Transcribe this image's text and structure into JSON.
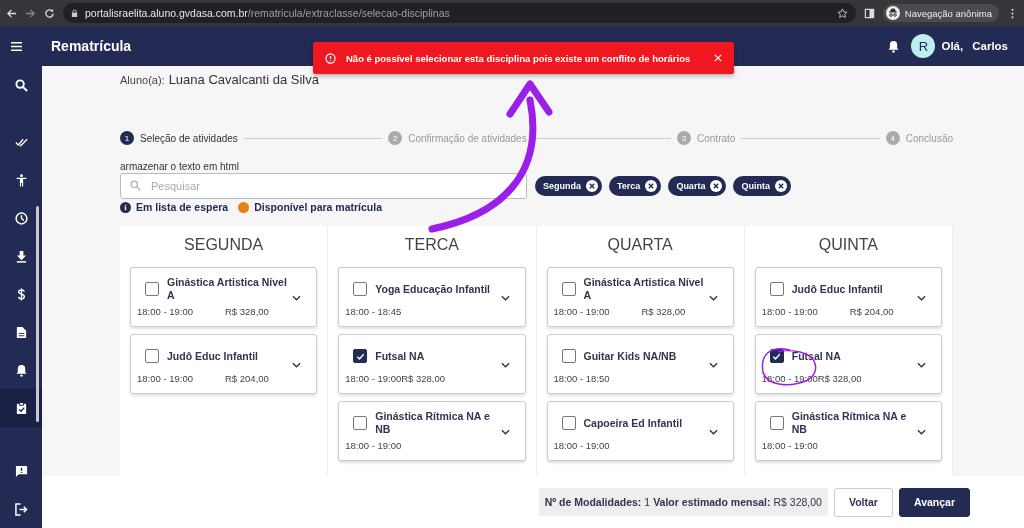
{
  "browser": {
    "url_domain": "portalisraelita.aluno.gvdasa.com.br",
    "url_path": "/rematricula/extraclasse/selecao-disciplinas",
    "profile": "Navegação anônima"
  },
  "header": {
    "title": "Rematrícula",
    "avatar": "R",
    "greeting": "Olá,",
    "user": "Carlos"
  },
  "sidebar": {
    "items": [
      {
        "kind": "search",
        "selected": false
      },
      {
        "kind": "double-check",
        "selected": false
      },
      {
        "kind": "person",
        "selected": false
      },
      {
        "kind": "clock",
        "selected": false
      },
      {
        "kind": "download",
        "selected": false
      },
      {
        "kind": "dollar",
        "selected": false
      },
      {
        "kind": "document",
        "selected": false
      },
      {
        "kind": "bell",
        "selected": false
      },
      {
        "kind": "clipboard",
        "selected": true
      },
      {
        "kind": "feedback",
        "selected": false
      },
      {
        "kind": "logout",
        "selected": false
      }
    ]
  },
  "toast": {
    "message": "Não é possível selecionar esta disciplina pois existe um conflito de horários"
  },
  "student": {
    "label": "Aluno(a):",
    "name": "Luana Cavalcanti da Silva"
  },
  "steps": [
    {
      "number": "1",
      "label": "Seleção de atividades",
      "selected": true
    },
    {
      "number": "2",
      "label": "Confirmação de atividades",
      "selected": false
    },
    {
      "number": "3",
      "label": "Contrato",
      "selected": false
    },
    {
      "number": "4",
      "label": "Conclusão",
      "selected": false
    }
  ],
  "search": {
    "label": "armazenar o texto em html",
    "placeholder": "Pesquisar"
  },
  "chips": [
    {
      "label": "Segunda"
    },
    {
      "label": "Terca"
    },
    {
      "label": "Quarta"
    },
    {
      "label": "Quinta"
    }
  ],
  "legend": [
    {
      "kind": "info",
      "label": "Em lista de espera"
    },
    {
      "kind": "dot",
      "label": "Disponível para matrícula"
    }
  ],
  "days": [
    {
      "name": "SEGUNDA",
      "activities": [
        {
          "name": "Ginástica Artistica Nível A",
          "time": "18:00 - 19:00",
          "price": "R$ 328,00",
          "checked": false
        },
        {
          "name": "Judô Educ Infantil",
          "time": "18:00 - 19:00",
          "price": "R$ 204,00",
          "checked": false
        }
      ]
    },
    {
      "name": "TERCA",
      "activities": [
        {
          "name": "Yoga Educação Infantil",
          "time": "18:00 - 18:45",
          "checked": false
        },
        {
          "name": "Futsal NA",
          "time": "18:00 - 19:00R$ 328,00",
          "checked": true
        },
        {
          "name": "Ginástica Rítmica NA e NB",
          "time": "18:00 - 19:00",
          "checked": false
        }
      ]
    },
    {
      "name": "QUARTA",
      "activities": [
        {
          "name": "Ginástica Artistica Nível A",
          "time": "18:00 - 19:00",
          "price": "R$ 328,00",
          "checked": false
        },
        {
          "name": "Guitar Kids NA/NB",
          "time": "18:00 - 18:50",
          "checked": false
        },
        {
          "name": "Capoeira Ed Infantil",
          "time": "18:00 - 19:00",
          "checked": false
        }
      ]
    },
    {
      "name": "QUINTA",
      "activities": [
        {
          "name": "Judô Educ Infantil",
          "time": "18:00 - 19:00",
          "price": "R$ 204,00",
          "checked": false
        },
        {
          "name": "Futsal NA",
          "time": "18:00 - 19:00R$ 328,00",
          "checked": true
        },
        {
          "name": "Ginástica Rítmica NA e NB",
          "time": "18:00 - 19:00",
          "checked": false
        }
      ]
    }
  ],
  "footer": {
    "count_label": "Nº de Modalidades:",
    "count": "1",
    "value_label": "Valor estimado mensal:",
    "value": "R$ 328,00",
    "buttons": [
      {
        "label": "Voltar",
        "kind": "secondary"
      },
      {
        "label": "Avançar",
        "kind": "primary"
      }
    ]
  }
}
